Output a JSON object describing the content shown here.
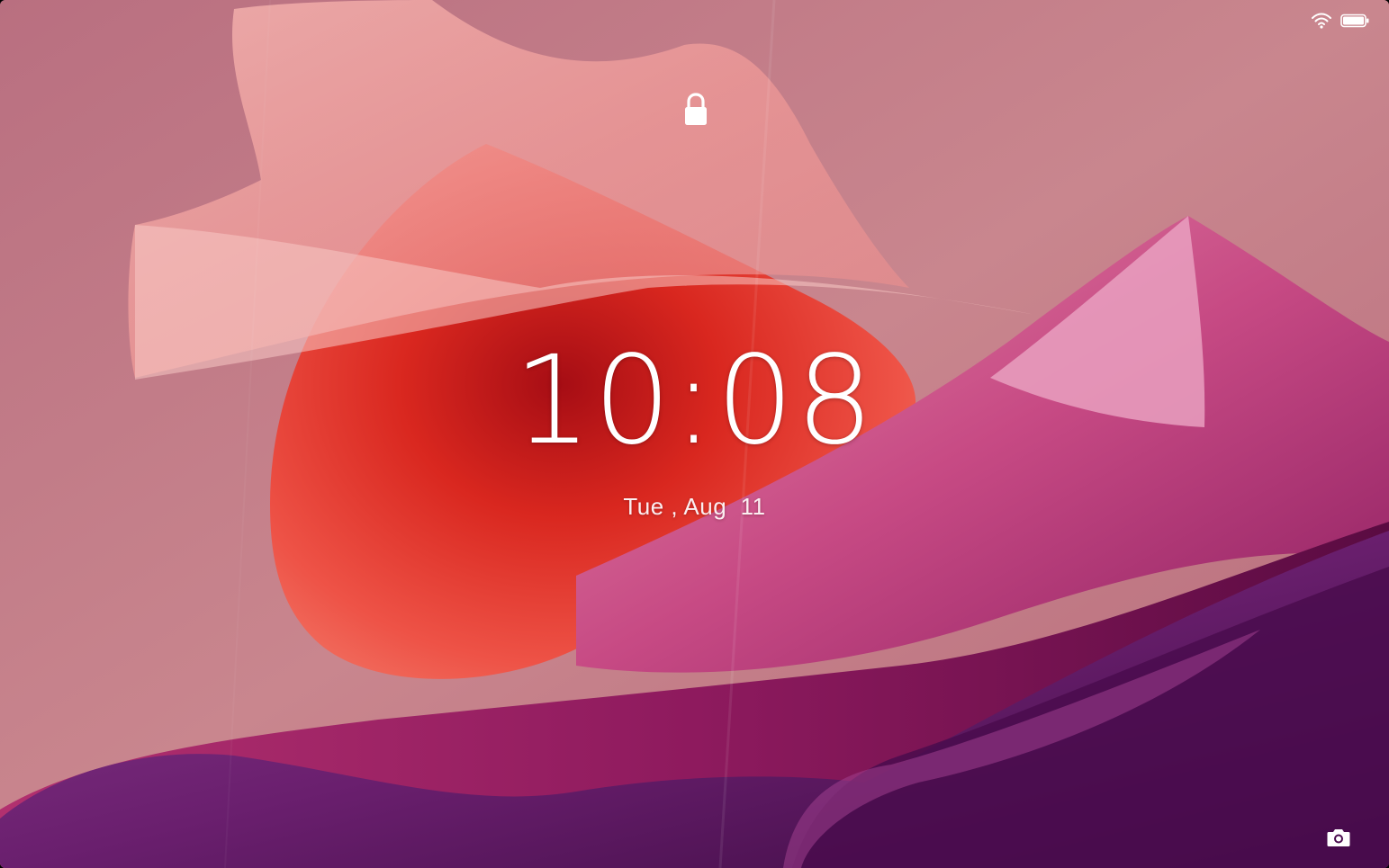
{
  "lock_screen": {
    "time": "10:08",
    "date": "Tue , Aug  11"
  },
  "status_bar": {
    "wifi_icon": "wifi-icon",
    "battery_icon": "battery-icon",
    "battery_level": 1.0
  },
  "icons": {
    "lock": "lock-icon",
    "camera": "camera-icon"
  },
  "colors": {
    "background": "#b8707e",
    "text": "#ffffff"
  }
}
